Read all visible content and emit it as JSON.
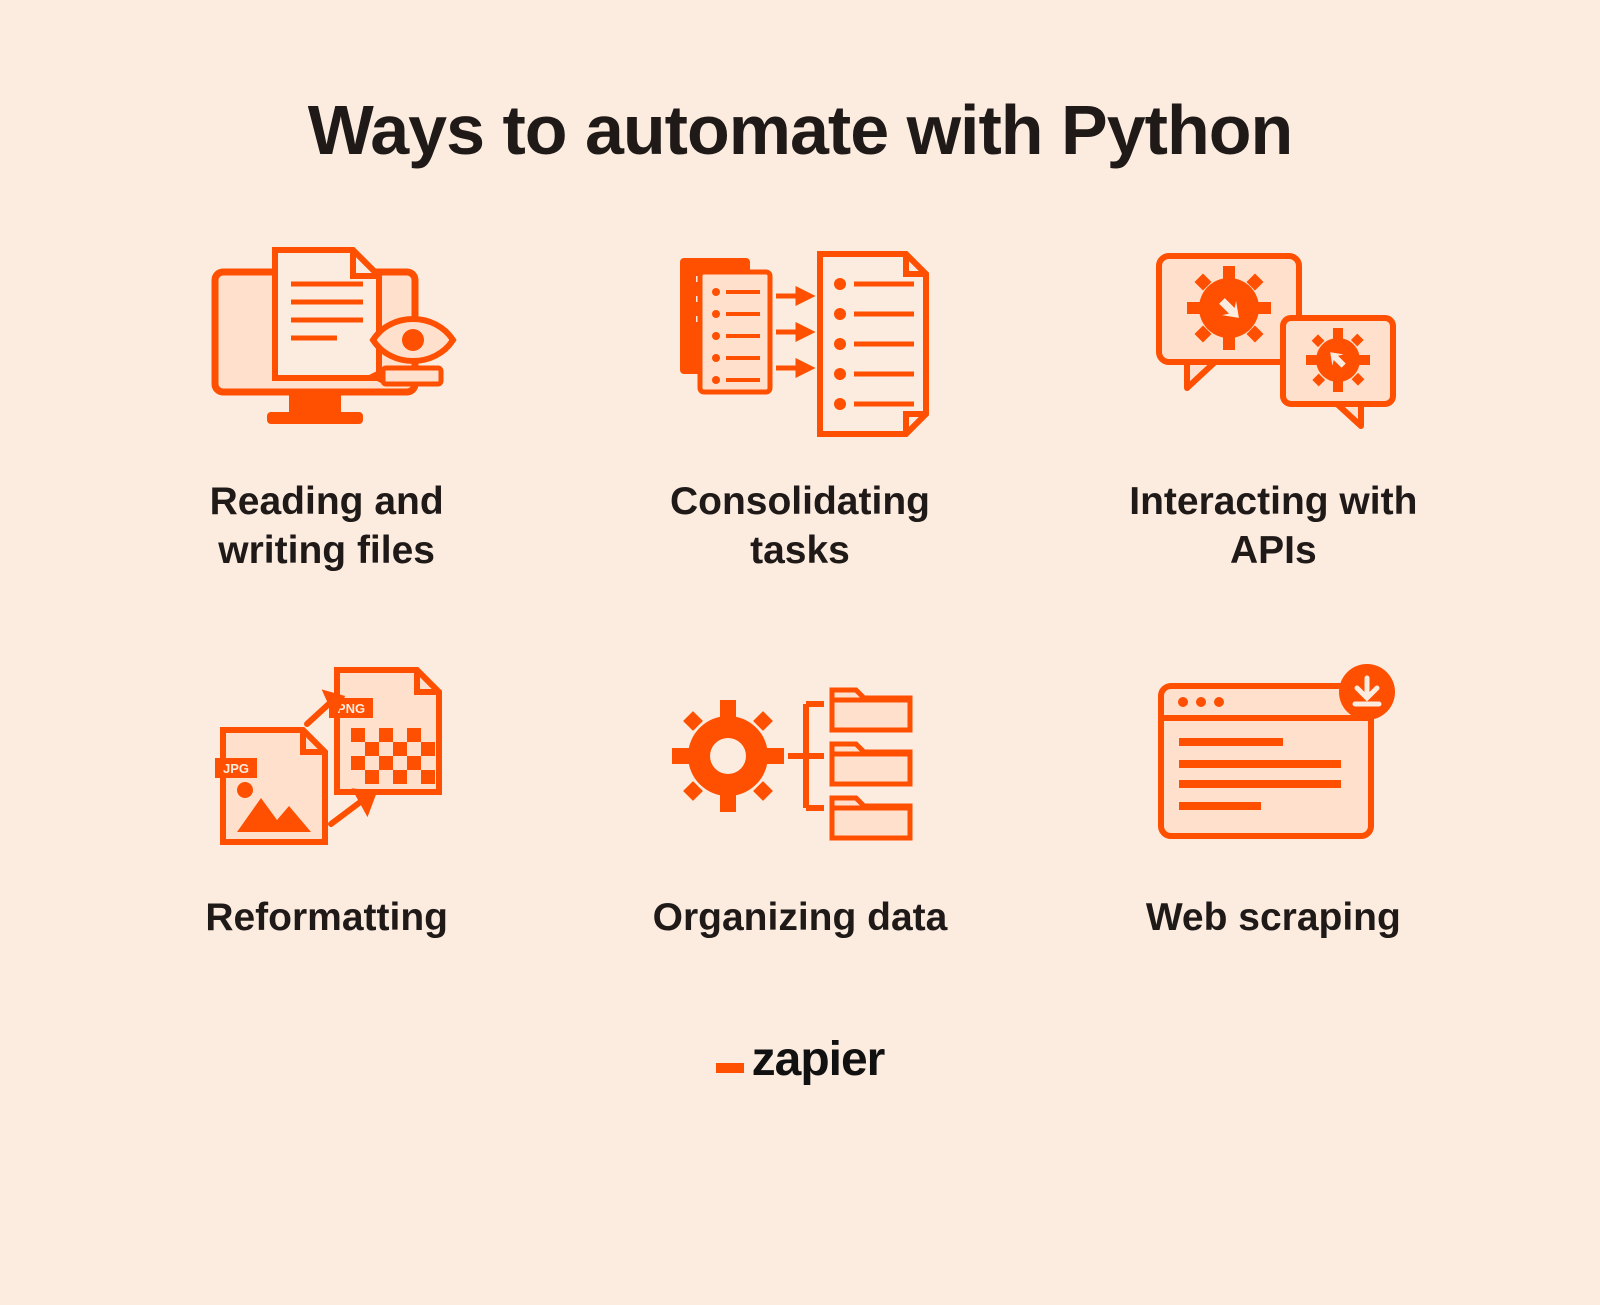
{
  "title": "Ways to automate with Python",
  "items": [
    {
      "label": "Reading and writing files",
      "icon": "reading-writing-files-icon"
    },
    {
      "label": "Consolidating tasks",
      "icon": "consolidating-tasks-icon"
    },
    {
      "label": "Interacting with APIs",
      "icon": "interacting-apis-icon"
    },
    {
      "label": "Reformatting",
      "icon": "reformatting-icon"
    },
    {
      "label": "Organizing data",
      "icon": "organizing-data-icon"
    },
    {
      "label": "Web scraping",
      "icon": "web-scraping-icon"
    }
  ],
  "footer": {
    "brand": "zapier"
  },
  "colors": {
    "accent": "#FF4F00",
    "accent_fill": "#FFE0CC",
    "accent_fill2": "#FF6A1F",
    "bg": "#FCECE0",
    "text": "#1F1A18"
  },
  "icon_text": {
    "jpg": "JPG",
    "png": "PNG"
  }
}
